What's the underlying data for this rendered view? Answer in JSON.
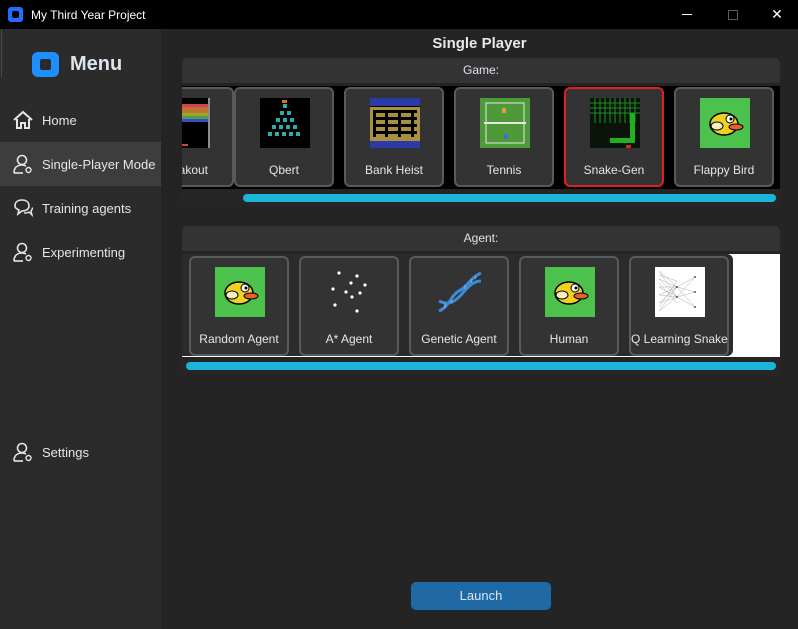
{
  "window": {
    "title": "My Third Year Project",
    "close_glyph": "✕"
  },
  "sidebar": {
    "title": "Menu",
    "items": [
      {
        "label": "Home",
        "icon": "home-icon"
      },
      {
        "label": "Single-Player Mode",
        "icon": "user-icon"
      },
      {
        "label": "Training agents",
        "icon": "chat-icon"
      },
      {
        "label": "Experimenting",
        "icon": "user-icon"
      }
    ],
    "settings": {
      "label": "Settings",
      "icon": "user-icon"
    }
  },
  "main": {
    "title": "Single Player",
    "game_section": {
      "header": "Game:",
      "games": [
        {
          "label": "Breakout",
          "visible_label": "out"
        },
        {
          "label": "Qbert"
        },
        {
          "label": "Bank Heist"
        },
        {
          "label": "Tennis"
        },
        {
          "label": "Snake-Gen",
          "selected": true
        },
        {
          "label": "Flappy Bird"
        }
      ]
    },
    "agent_section": {
      "header": "Agent:",
      "agents": [
        {
          "label": "Random Agent"
        },
        {
          "label": "A* Agent"
        },
        {
          "label": "Genetic  Agent"
        },
        {
          "label": "Human"
        },
        {
          "label": "Q Learning Snake"
        }
      ]
    },
    "launch_label": "Launch"
  },
  "colors": {
    "accent": "#1f6aa5",
    "scrollbar": "#1cb4d8",
    "selected_border": "#e02020",
    "background": "#242424",
    "sidebar": "#2b2b2b"
  }
}
